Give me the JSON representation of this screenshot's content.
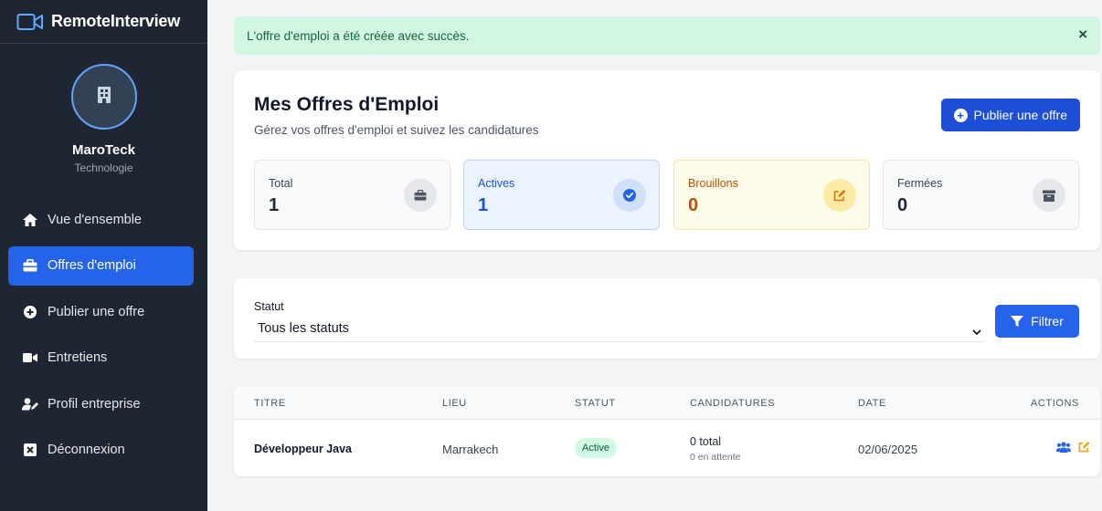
{
  "app": {
    "name": "RemoteInterview"
  },
  "company": {
    "name": "MaroTeck",
    "sector": "Technologie"
  },
  "sidebar": {
    "items": [
      {
        "label": "Vue d'ensemble",
        "icon": "home-icon"
      },
      {
        "label": "Offres d'emploi",
        "icon": "briefcase-icon",
        "active": true
      },
      {
        "label": "Publier une offre",
        "icon": "plus-circle-icon"
      },
      {
        "label": "Entretiens",
        "icon": "video-icon"
      },
      {
        "label": "Profil entreprise",
        "icon": "user-edit-icon"
      },
      {
        "label": "Déconnexion",
        "icon": "logout-icon"
      }
    ]
  },
  "alert": {
    "message": "L'offre d'emploi a été créée avec succès.",
    "close": "×"
  },
  "header": {
    "title": "Mes Offres d'Emploi",
    "subtitle": "Gérez vos offres d'emploi et suivez les candidatures",
    "publish_label": "Publier une offre"
  },
  "stats": [
    {
      "label": "Total",
      "value": "1",
      "icon": "briefcase-icon"
    },
    {
      "label": "Actives",
      "value": "1",
      "icon": "check-circle-icon"
    },
    {
      "label": "Brouillons",
      "value": "0",
      "icon": "edit-icon"
    },
    {
      "label": "Fermées",
      "value": "0",
      "icon": "archive-icon"
    }
  ],
  "filter": {
    "label": "Statut",
    "selected": "Tous les statuts",
    "button_label": "Filtrer"
  },
  "table": {
    "headers": [
      "Titre",
      "Lieu",
      "Statut",
      "Candidatures",
      "Date",
      "Actions"
    ],
    "rows": [
      {
        "title": "Développeur Java",
        "location": "Marrakech",
        "status": "Active",
        "applications_total": "0 total",
        "applications_pending": "0 en attente",
        "date": "02/06/2025"
      }
    ]
  },
  "colors": {
    "primary": "#2563eb",
    "sidebar_bg": "#1f2633",
    "success_bg": "#d1f7e2",
    "warning": "#f59e0b"
  }
}
